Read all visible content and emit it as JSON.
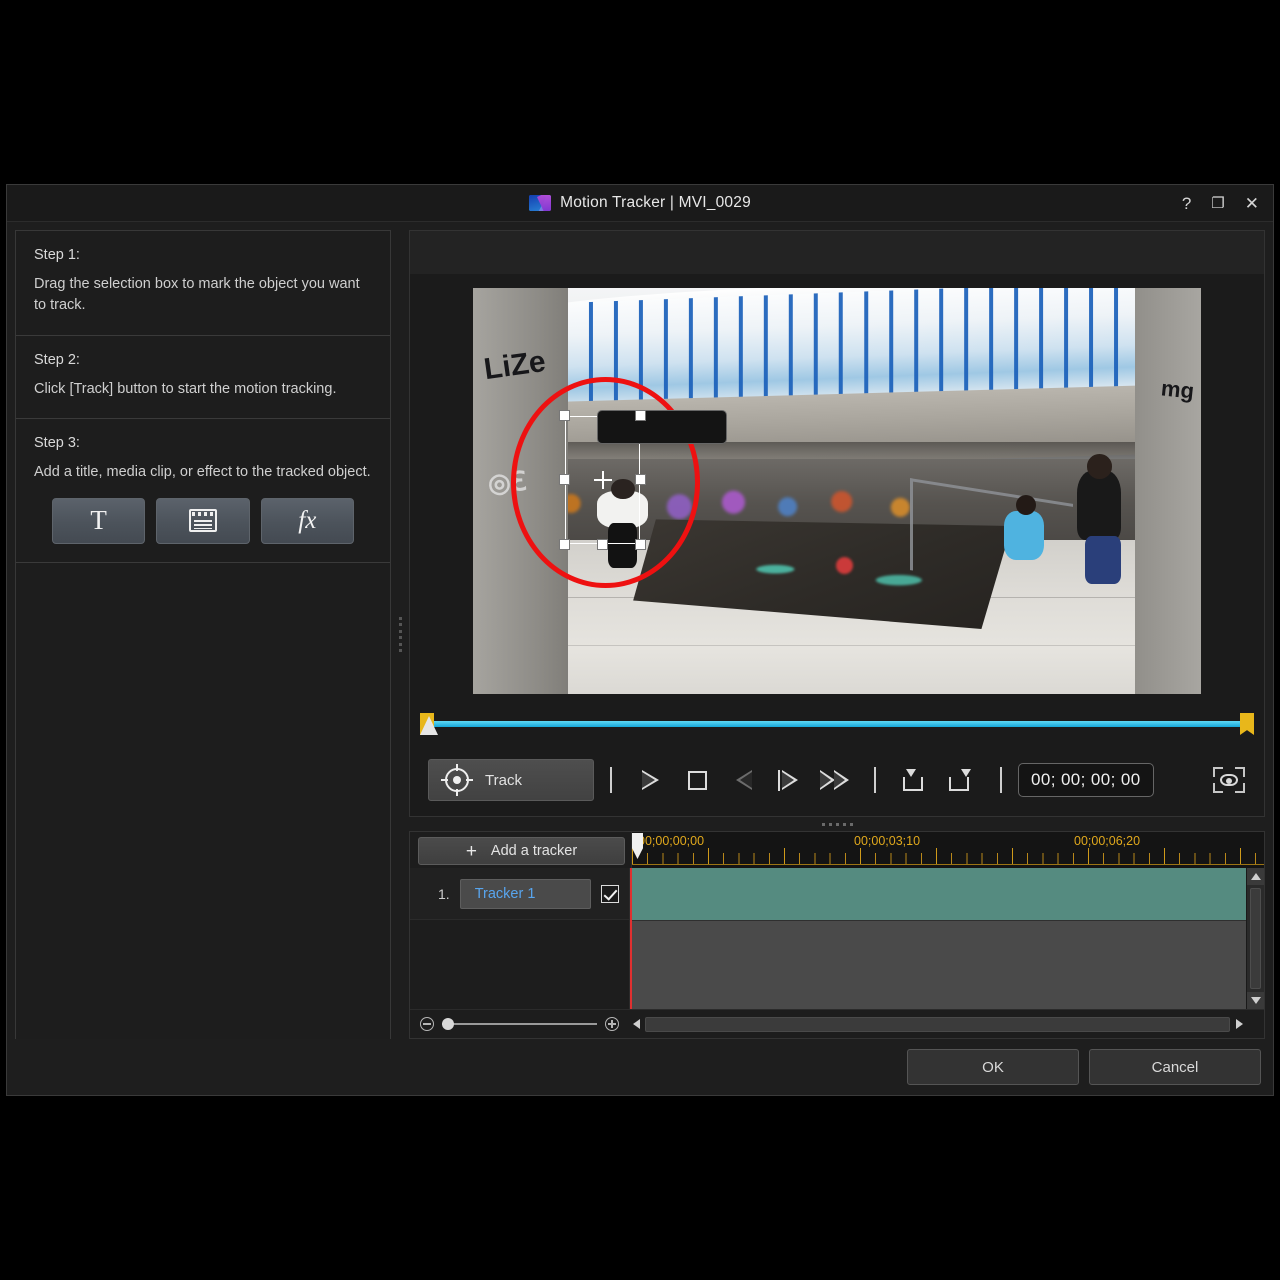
{
  "window": {
    "title": "Motion Tracker | MVI_0029",
    "logo_icon": "motion-tracker-logo",
    "help_label": "?",
    "maximize_label": "❐",
    "close_label": "✕"
  },
  "left_panel": {
    "steps": [
      {
        "title": "Step 1:",
        "body": "Drag the selection box to mark the object you want to track."
      },
      {
        "title": "Step 2:",
        "body": "Click [Track] button to start the motion tracking."
      },
      {
        "title": "Step 3:",
        "body": "Add a title, media clip, or effect to the tracked object."
      }
    ],
    "buttons": [
      {
        "name": "add-title-button",
        "glyph": "T",
        "icon": "text-title-icon"
      },
      {
        "name": "add-media-clip-button",
        "glyph": "",
        "icon": "media-clip-icon"
      },
      {
        "name": "add-effect-button",
        "glyph": "fx",
        "icon": "effect-fx-icon"
      }
    ]
  },
  "preview": {
    "selection": {
      "ellipse_color": "#ee1111",
      "handle_color": "#ffffff",
      "center_icon": "crosshair-icon"
    },
    "scrub": {
      "in_marker": "mark-in-handle",
      "out_marker": "mark-out-handle",
      "playhead": "playhead-handle",
      "bar_color": "#2bb8e0",
      "marker_color": "#e8b71b"
    }
  },
  "transport": {
    "track_button": {
      "label": "Track",
      "icon": "target-crosshair-icon"
    },
    "buttons": [
      {
        "name": "play-button",
        "icon": "play-icon",
        "label": "Play"
      },
      {
        "name": "stop-button",
        "icon": "stop-icon",
        "label": "Stop"
      },
      {
        "name": "previous-frame-button",
        "icon": "previous-frame-icon",
        "label": "Previous Frame"
      },
      {
        "name": "next-frame-button",
        "icon": "next-frame-icon",
        "label": "Next Frame"
      },
      {
        "name": "fast-forward-button",
        "icon": "fast-forward-icon",
        "label": "Fast Forward"
      },
      {
        "name": "mark-in-button",
        "icon": "mark-in-icon",
        "label": "Mark In"
      },
      {
        "name": "mark-out-button",
        "icon": "mark-out-icon",
        "label": "Mark Out"
      }
    ],
    "timecode": "00; 00; 00; 00",
    "preview_toggle": {
      "name": "show-tracker-button",
      "icon": "eye-in-brackets-icon"
    }
  },
  "timeline": {
    "add_tracker_label": "Add a tracker",
    "add_tracker_icon": "plus-icon",
    "ruler_labels": [
      "00;00;00;00",
      "00;00;03;10",
      "00;00;06;20"
    ],
    "ruler_label_color": "#e0a81c",
    "clip_color": "#558b80",
    "playhead_color": "#e03030",
    "rows": [
      {
        "index": "1.",
        "name": "Tracker 1",
        "enabled": true
      }
    ],
    "zoom": {
      "minus_icon": "zoom-out-icon",
      "plus_icon": "zoom-in-icon",
      "value": 0
    },
    "scroll": {
      "left_icon": "scroll-left-icon",
      "right_icon": "scroll-right-icon",
      "up_icon": "scroll-up-icon",
      "down_icon": "scroll-down-icon"
    }
  },
  "footer": {
    "ok_label": "OK",
    "cancel_label": "Cancel"
  }
}
